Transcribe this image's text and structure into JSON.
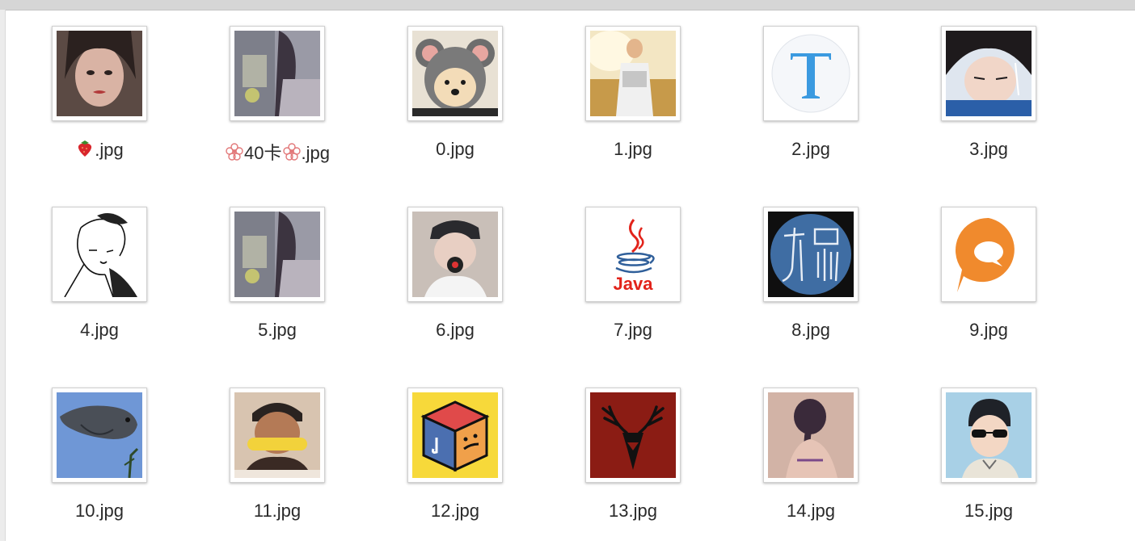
{
  "window": {
    "accent": "#d6d6d6"
  },
  "files": [
    {
      "name": ".jpg",
      "prefix_icon": "strawberry-emoji"
    },
    {
      "name": "40卡",
      "suffix": ".jpg",
      "prefix_icon": "flower-emoji",
      "suffix_icon": "flower-emoji"
    },
    {
      "name": "0.jpg"
    },
    {
      "name": "1.jpg"
    },
    {
      "name": "2.jpg"
    },
    {
      "name": "3.jpg"
    },
    {
      "name": "4.jpg"
    },
    {
      "name": "5.jpg"
    },
    {
      "name": "6.jpg"
    },
    {
      "name": "7.jpg",
      "thumb_text": "Java"
    },
    {
      "name": "8.jpg"
    },
    {
      "name": "9.jpg"
    },
    {
      "name": "10.jpg"
    },
    {
      "name": "11.jpg"
    },
    {
      "name": "12.jpg"
    },
    {
      "name": "13.jpg"
    },
    {
      "name": "14.jpg"
    },
    {
      "name": "15.jpg"
    }
  ]
}
